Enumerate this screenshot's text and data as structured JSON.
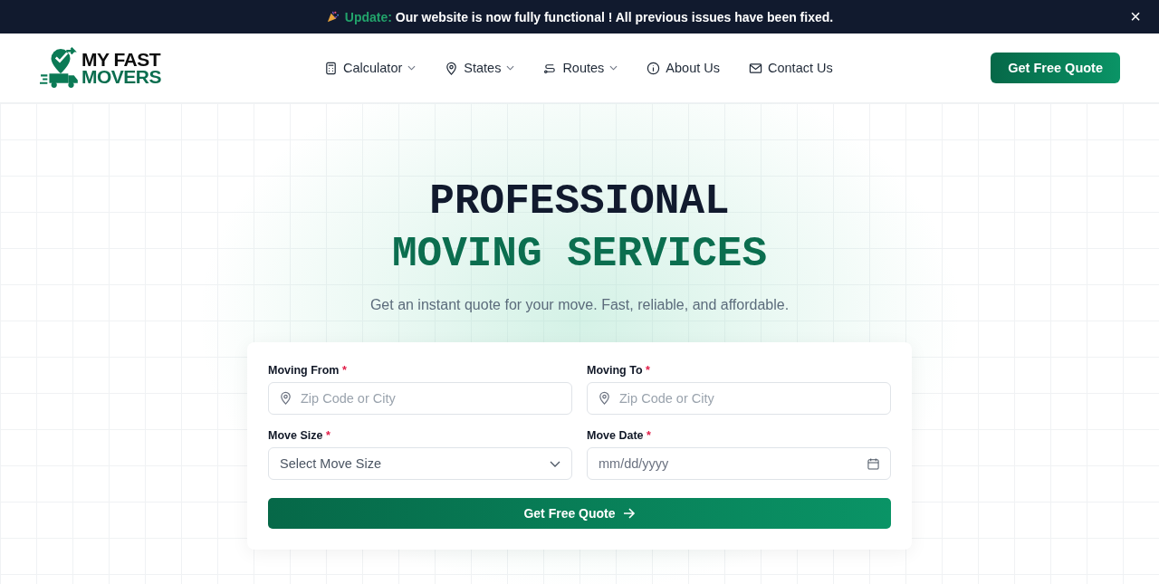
{
  "announcement": {
    "label": "Update:",
    "message": "Our website is now fully functional ! All previous issues have been fixed.",
    "close": "×"
  },
  "logo": {
    "line_1": "MY FAST",
    "line_2": "MOVERS"
  },
  "nav": [
    {
      "label": "Calculator",
      "kind": "calculator",
      "dropdown": true
    },
    {
      "label": "States",
      "kind": "pin",
      "dropdown": true
    },
    {
      "label": "Routes",
      "kind": "route",
      "dropdown": true
    },
    {
      "label": "About Us",
      "kind": "info",
      "dropdown": false
    },
    {
      "label": "Contact Us",
      "kind": "mail",
      "dropdown": false
    }
  ],
  "header_button": "Get Free Quote",
  "hero": {
    "title_lines": [
      {
        "text": "PROFESSIONAL",
        "kind": "dark"
      },
      {
        "text": "MOVING SERVICES",
        "kind": "accent"
      }
    ],
    "subtitle": "Get an instant quote for your move. Fast, reliable, and affordable."
  },
  "form": {
    "fields": [
      {
        "label": "Moving From",
        "required_mark": "*",
        "kind": "location",
        "placeholder": "Zip Code or City"
      },
      {
        "label": "Moving To",
        "required_mark": "*",
        "kind": "location",
        "placeholder": "Zip Code or City"
      },
      {
        "label": "Move Size",
        "required_mark": "*",
        "kind": "select",
        "placeholder": "Select Move Size"
      },
      {
        "label": "Move Date",
        "required_mark": "*",
        "kind": "date",
        "placeholder": "mm/dd/yyyy"
      }
    ],
    "submit": "Get Free Quote"
  }
}
